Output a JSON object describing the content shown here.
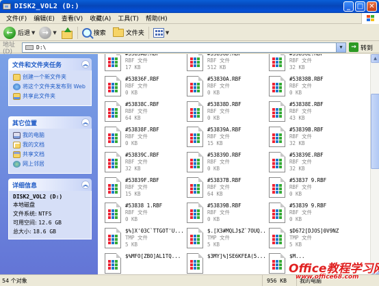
{
  "window": {
    "title": "DISK2_VOL2 (D:)"
  },
  "menu": [
    "文件(F)",
    "编辑(E)",
    "查看(V)",
    "收藏(A)",
    "工具(T)",
    "帮助(H)"
  ],
  "toolbar": {
    "back": "后退",
    "search": "搜索",
    "folders": "文件夹"
  },
  "address": {
    "label": "地址(D)",
    "value": "D:\\",
    "go": "转到"
  },
  "sidebar": {
    "tasks": {
      "title": "文件和文件夹任务",
      "items": [
        "创建一个新文件夹",
        "将这个文件夹发布到 Web",
        "共享此文件夹"
      ]
    },
    "places": {
      "title": "其它位置",
      "items": [
        "我的电脑",
        "我的文档",
        "共享文档",
        "网上邻居"
      ]
    },
    "details": {
      "title": "详细信息",
      "name": "DISK2_VOL2 (D:)",
      "type": "本地磁盘",
      "fs_label": "文件系统:",
      "fs_value": "NTFS",
      "free_label": "可用空间:",
      "free_value": "12.6 GB",
      "total_label": "总大小:",
      "total_value": "18.6 GB"
    }
  },
  "files": [
    {
      "name": "#5383AB.RBF",
      "type": "RBF 文件",
      "size": "17 KB"
    },
    {
      "name": "#53836D.RBF",
      "type": "RBF 文件",
      "size": "512 KB"
    },
    {
      "name": "#53836E.RBF",
      "type": "RBF 文件",
      "size": "32 KB"
    },
    {
      "name": "#53836F.RBF",
      "type": "RBF 文件",
      "size": "0 KB"
    },
    {
      "name": "#53830A.RBF",
      "type": "RBF 文件",
      "size": "0 KB"
    },
    {
      "name": "#53838B.RBF",
      "type": "RBF 文件",
      "size": "0 KB"
    },
    {
      "name": "#53838C.RBF",
      "type": "RBF 文件",
      "size": "64 KB"
    },
    {
      "name": "#53838D.RBF",
      "type": "RBF 文件",
      "size": "0 KB"
    },
    {
      "name": "#53838E.RBF",
      "type": "RBF 文件",
      "size": "43 KB"
    },
    {
      "name": "#53838F.RBF",
      "type": "RBF 文件",
      "size": "0 KB"
    },
    {
      "name": "#53839A.RBF",
      "type": "RBF 文件",
      "size": "15 KB"
    },
    {
      "name": "#53839B.RBF",
      "type": "RBF 文件",
      "size": "32 KB"
    },
    {
      "name": "#53839C.RBF",
      "type": "RBF 文件",
      "size": "32 KB"
    },
    {
      "name": "#53839D.RBF",
      "type": "RBF 文件",
      "size": "0 KB"
    },
    {
      "name": "#53839E.RBF",
      "type": "RBF 文件",
      "size": "32 KB"
    },
    {
      "name": "#53839F.RBF",
      "type": "RBF 文件",
      "size": "15 KB"
    },
    {
      "name": "#53837B.RBF",
      "type": "RBF 文件",
      "size": "64 KB"
    },
    {
      "name": "#53837 9.RBF",
      "type": "RBF 文件",
      "size": "0 KB"
    },
    {
      "name": "#53838 1.RBF",
      "type": "RBF 文件",
      "size": "0 KB"
    },
    {
      "name": "#53839B.RBF",
      "type": "RBF 文件",
      "size": "0 KB"
    },
    {
      "name": "#53839 9.RBF",
      "type": "RBF 文件",
      "size": "0 KB"
    },
    {
      "name": "$%]X'03C`TTGOT'U...",
      "type": "TMP 文件",
      "size": "5 KB"
    },
    {
      "name": "$.[X3#MQLJ$Z`7OUQ...",
      "type": "TMP 文件",
      "size": "5 KB"
    },
    {
      "name": "$D672[DJOS]0V9NZ",
      "type": "TMP 文件",
      "size": "5 KB"
    },
    {
      "name": "$%MFO[ZBO]AL1TQ...",
      "type": "",
      "size": ""
    },
    {
      "name": "$3MY]%]SE6KFEA(5...",
      "type": "",
      "size": ""
    },
    {
      "name": "$M...",
      "type": "",
      "size": ""
    }
  ],
  "status": {
    "count": "54 个对象",
    "size": "956 KB",
    "location": "我的电脑"
  },
  "watermark": {
    "title": "Office教程学习网",
    "url": "www.office68.com"
  }
}
